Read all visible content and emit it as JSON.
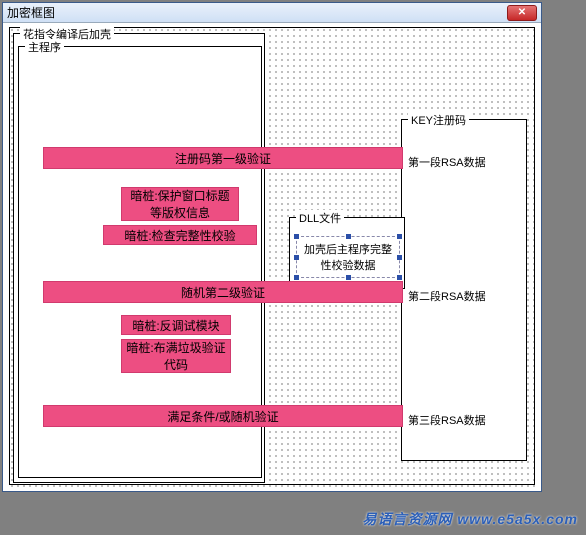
{
  "window": {
    "title": "加密框图"
  },
  "outer_group": {
    "label": "花指令编译后加壳"
  },
  "inner_group": {
    "label": "主程序"
  },
  "bars": {
    "reg1": "注册码第一级验证",
    "stub1": "暗桩:保护窗口标题等版权信息",
    "stub2": "暗桩:检查完整性校验",
    "rand2": "随机第二级验证",
    "stub3": "暗桩:反调试模块",
    "stub4": "暗桩:布满垃圾验证代码",
    "cond": "满足条件/或随机验证"
  },
  "dll": {
    "label": "DLL文件",
    "text": "加壳后主程序完整性校验数据"
  },
  "key": {
    "label": "KEY注册码",
    "seg1": "第一段RSA数据",
    "seg2": "第二段RSA数据",
    "seg3": "第三段RSA数据"
  },
  "watermark": "易语言资源网  www.e5a5x.com"
}
